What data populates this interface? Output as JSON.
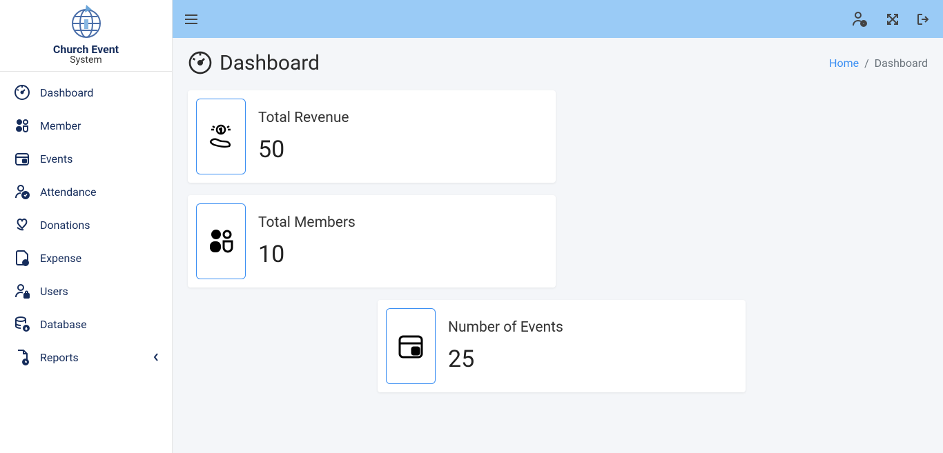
{
  "brand": {
    "title": "Church Event",
    "subtitle": "System"
  },
  "sidebar": {
    "items": [
      {
        "label": "Dashboard"
      },
      {
        "label": "Member"
      },
      {
        "label": "Events"
      },
      {
        "label": "Attendance"
      },
      {
        "label": "Donations"
      },
      {
        "label": "Expense"
      },
      {
        "label": "Users"
      },
      {
        "label": "Database"
      },
      {
        "label": "Reports"
      }
    ]
  },
  "page": {
    "title": "Dashboard"
  },
  "breadcrumb": {
    "home": "Home",
    "sep": "/",
    "current": "Dashboard"
  },
  "cards": {
    "revenue": {
      "label": "Total Revenue",
      "value": "50"
    },
    "members": {
      "label": "Total Members",
      "value": "10"
    },
    "events": {
      "label": "Number of Events",
      "value": "25"
    }
  }
}
